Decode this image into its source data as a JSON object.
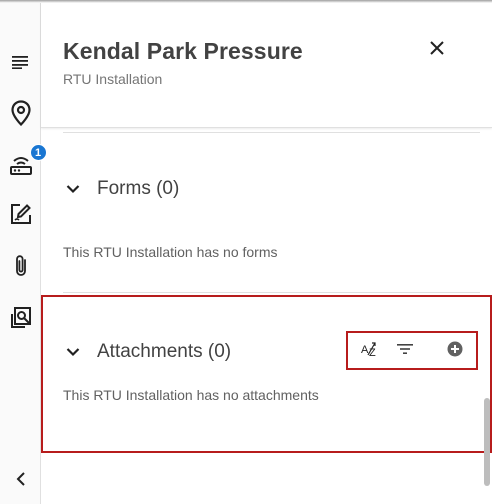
{
  "header": {
    "title": "Kendal Park Pressure",
    "subtitle": "RTU Installation",
    "close_icon": "close-icon"
  },
  "rail": {
    "items": [
      {
        "icon": "list-icon"
      },
      {
        "icon": "location-pin-icon"
      },
      {
        "icon": "rtu-icon",
        "badge": "1"
      },
      {
        "icon": "edit-form-icon"
      },
      {
        "icon": "paperclip-icon"
      },
      {
        "icon": "search-document-icon"
      },
      {
        "icon": "chevron-left-icon"
      }
    ]
  },
  "forms": {
    "title": "Forms (0)",
    "empty": "This RTU Installation has no forms"
  },
  "attachments": {
    "title": "Attachments (0)",
    "empty": "This RTU Installation has no attachments",
    "toolbar": {
      "sort_icon": "sort-az-icon",
      "filter_icon": "filter-icon",
      "add_icon": "add-circle-icon"
    }
  },
  "colors": {
    "accent": "#1976d2",
    "highlight": "#b71c1c",
    "icon": "#212121"
  }
}
